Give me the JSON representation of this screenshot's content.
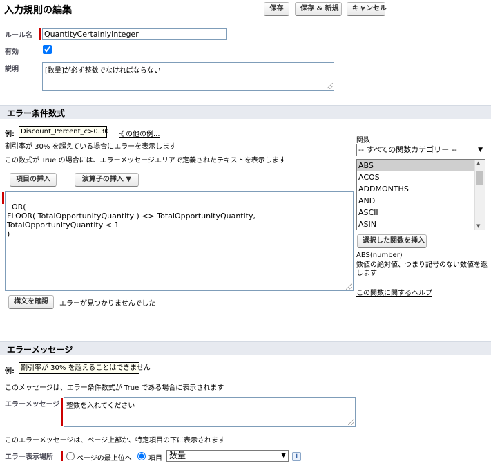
{
  "page": {
    "title": "入力規則の編集"
  },
  "toolbar": {
    "save_label": "保存",
    "save_new_label": "保存 & 新規",
    "cancel_label": "キャンセル"
  },
  "rule": {
    "name_label": "ルール名",
    "name_value": "QuantityCertainlyInteger",
    "active_label": "有効",
    "active_checked": true,
    "description_label": "説明",
    "description_value": "[数量]が必ず整数でなければならない"
  },
  "formula_section": {
    "title": "エラー条件数式",
    "example_label": "例:",
    "example_value": "Discount_Percent_c>0.30",
    "more_examples_link": "その他の例...",
    "example_desc": "割引率が 30% を超えている場合にエラーを表示します",
    "help_text": "この数式が True の場合には、エラーメッセージエリアで定義されたテキストを表示します",
    "insert_field_button": "項目の挿入",
    "insert_operator_button": "演算子の挿入 ▼",
    "formula_value": "OR(\nFLOOR( TotalOpportunityQuantity ) <> TotalOpportunityQuantity,\nTotalOpportunityQuantity < 1\n)",
    "check_syntax_button": "構文を確認",
    "syntax_result": "エラーが見つかりませんでした"
  },
  "functions": {
    "label": "関数",
    "category_selected": "-- すべての関数カテゴリー --",
    "items": [
      "ABS",
      "ACOS",
      "ADDMONTHS",
      "AND",
      "ASCII",
      "ASIN"
    ],
    "selected_index": 0,
    "insert_selected_button": "選択した関数を挿入",
    "signature": "ABS(number)",
    "description": "数値の絶対値、つまり記号のない数値を返します",
    "help_link": "この関数に関するヘルプ"
  },
  "message_section": {
    "title": "エラーメッセージ",
    "example_label": "例:",
    "example_value": "割引率が 30% を超えることはできません",
    "help_text": "このメッセージは、エラー条件数式が True である場合に表示されます",
    "error_message_label": "エラーメッセージ",
    "error_message_value": "整数を入れてください",
    "location_help": "このエラーメッセージは、ページ上部か、特定項目の下に表示されます",
    "location_label": "エラー表示場所",
    "location_top_label": "ページの最上位へ",
    "location_field_label": "項目",
    "location_selected": "field",
    "field_selected": "数量",
    "info_icon_text": "i"
  }
}
